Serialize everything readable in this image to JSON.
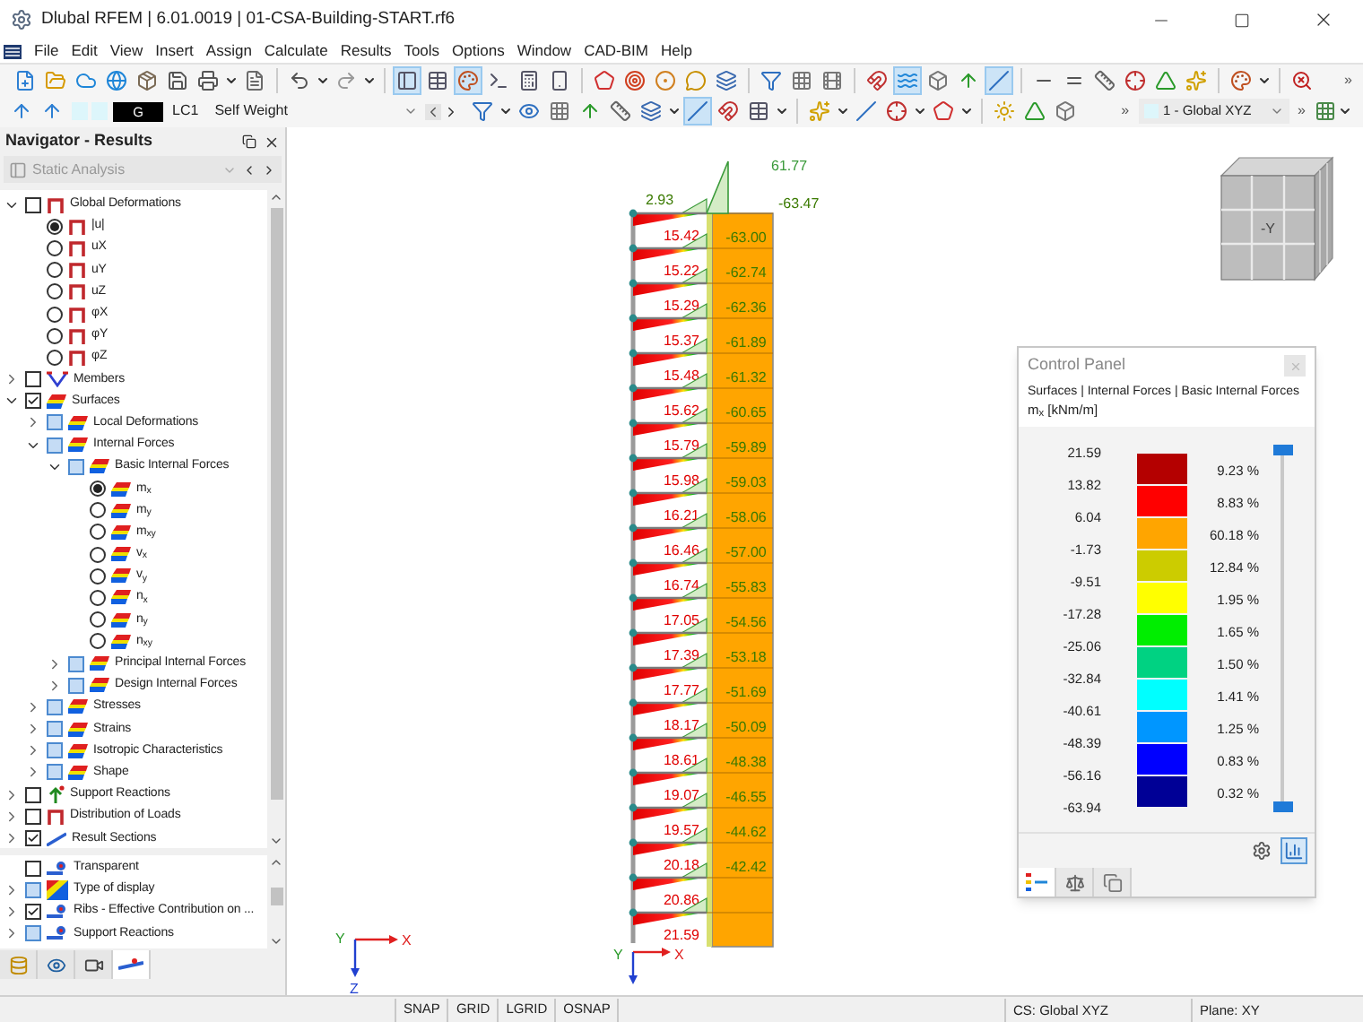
{
  "window": {
    "title": "Dlubal RFEM | 6.01.0019 | 01-CSA-Building-START.rf6"
  },
  "menu": [
    "File",
    "Edit",
    "View",
    "Insert",
    "Assign",
    "Calculate",
    "Results",
    "Tools",
    "Options",
    "Window",
    "CAD-BIM",
    "Help"
  ],
  "toolbar_1": [
    {
      "kind": "new",
      "selected": false
    },
    {
      "kind": "open",
      "selected": false
    },
    {
      "kind": "cloud",
      "selected": false
    },
    {
      "kind": "web",
      "selected": false
    },
    {
      "kind": "box",
      "selected": false
    },
    {
      "kind": "save",
      "selected": false
    },
    {
      "kind": "print",
      "selected": false
    },
    {
      "kind": "caret",
      "selected": false
    },
    {
      "kind": "report",
      "selected": false
    },
    {
      "kind": "sep"
    },
    {
      "kind": "undo",
      "selected": false
    },
    {
      "kind": "caret",
      "selected": false
    },
    {
      "kind": "redo",
      "selected": false
    },
    {
      "kind": "caret",
      "selected": false
    },
    {
      "kind": "sep"
    },
    {
      "kind": "panel",
      "selected": true
    },
    {
      "kind": "table",
      "selected": false
    },
    {
      "kind": "palette",
      "selected": true
    },
    {
      "kind": "terminal",
      "selected": false
    },
    {
      "kind": "calculator",
      "selected": false
    },
    {
      "kind": "phone",
      "selected": false
    },
    {
      "kind": "sep"
    },
    {
      "kind": "pentagon",
      "selected": false
    },
    {
      "kind": "target",
      "selected": false
    },
    {
      "kind": "dot",
      "selected": false
    },
    {
      "kind": "speech",
      "selected": false
    },
    {
      "kind": "layers",
      "selected": false
    },
    {
      "kind": "sep"
    },
    {
      "kind": "filter",
      "selected": false
    },
    {
      "kind": "grid",
      "selected": false
    },
    {
      "kind": "film",
      "selected": false
    },
    {
      "kind": "sep"
    },
    {
      "kind": "magnet",
      "selected": false
    },
    {
      "kind": "waves",
      "selected": true
    },
    {
      "kind": "cube",
      "selected": false
    },
    {
      "kind": "arrow",
      "selected": false
    },
    {
      "kind": "slash",
      "selected": true
    },
    {
      "kind": "sep"
    },
    {
      "kind": "minus",
      "selected": false
    },
    {
      "kind": "equal",
      "selected": false
    },
    {
      "kind": "ruler",
      "selected": false
    },
    {
      "kind": "crosshair",
      "selected": false
    },
    {
      "kind": "triangle",
      "selected": false
    },
    {
      "kind": "sparkles",
      "selected": false
    },
    {
      "kind": "sep"
    },
    {
      "kind": "palette",
      "selected": false
    },
    {
      "kind": "caret",
      "selected": false
    },
    {
      "kind": "sep"
    },
    {
      "kind": "search-x",
      "selected": false
    }
  ],
  "toolbar_1_more": "»",
  "load_bar": {
    "tag": "G",
    "case": "LC1",
    "case_name": "Self Weight"
  },
  "toolbar_2": [
    {
      "kind": "filter",
      "selected": false
    },
    {
      "kind": "caret",
      "selected": false
    },
    {
      "kind": "eye",
      "selected": false
    },
    {
      "kind": "grid",
      "selected": false
    },
    {
      "kind": "arrow",
      "selected": false
    },
    {
      "kind": "ruler",
      "selected": false
    },
    {
      "kind": "layers",
      "selected": false
    },
    {
      "kind": "caret",
      "selected": false
    },
    {
      "kind": "slash",
      "selected": true
    },
    {
      "kind": "magnet",
      "selected": false
    },
    {
      "kind": "table",
      "selected": false
    },
    {
      "kind": "caret",
      "selected": false
    },
    {
      "kind": "sep"
    },
    {
      "kind": "sparkles",
      "selected": false
    },
    {
      "kind": "caret",
      "selected": false
    },
    {
      "kind": "slash",
      "selected": false
    },
    {
      "kind": "crosshair",
      "selected": false
    },
    {
      "kind": "caret",
      "selected": false
    },
    {
      "kind": "pentagon",
      "selected": false
    },
    {
      "kind": "caret",
      "selected": false
    },
    {
      "kind": "sep"
    },
    {
      "kind": "sun",
      "selected": false
    },
    {
      "kind": "triangle",
      "selected": false
    },
    {
      "kind": "cube",
      "selected": false
    }
  ],
  "toolbar_2_more": "»",
  "cs_select": "1 - Global XYZ",
  "toolbar_2_end_more": "»",
  "navigator": {
    "title": "Navigator - Results",
    "analysis": "Static Analysis",
    "tree": [
      {
        "label": "Global Deformations",
        "expanded": true,
        "checked": false,
        "highlighted": false,
        "kind": "deform",
        "children": [
          {
            "label": "|u|",
            "selected": true,
            "kind": "deform"
          },
          {
            "label": "uX",
            "selected": false,
            "kind": "deform"
          },
          {
            "label": "uY",
            "selected": false,
            "kind": "deform"
          },
          {
            "label": "uZ",
            "selected": false,
            "kind": "deform"
          },
          {
            "label": "φX",
            "selected": false,
            "kind": "deform"
          },
          {
            "label": "φY",
            "selected": false,
            "kind": "deform"
          },
          {
            "label": "φZ",
            "selected": false,
            "kind": "deform"
          }
        ]
      },
      {
        "label": "Members",
        "expanded": false,
        "checked": false,
        "highlighted": false,
        "kind": "member"
      },
      {
        "label": "Surfaces",
        "expanded": true,
        "checked": true,
        "highlighted": false,
        "kind": "surface",
        "children": [
          {
            "label": "Local Deformations",
            "expanded": false,
            "checked": false,
            "highlighted": true,
            "kind": "surface"
          },
          {
            "label": "Internal Forces",
            "expanded": true,
            "checked": false,
            "highlighted": true,
            "kind": "surface",
            "children": [
              {
                "label": "Basic Internal Forces",
                "expanded": true,
                "checked": false,
                "highlighted": true,
                "kind": "surface",
                "children": [
                  {
                    "label": "m$_{x}$",
                    "selected": true,
                    "kind": "surface"
                  },
                  {
                    "label": "m$_{y}$",
                    "selected": false,
                    "kind": "surface"
                  },
                  {
                    "label": "m$_{xy}$",
                    "selected": false,
                    "kind": "surface"
                  },
                  {
                    "label": "v$_{x}$",
                    "selected": false,
                    "kind": "surface"
                  },
                  {
                    "label": "v$_{y}$",
                    "selected": false,
                    "kind": "surface"
                  },
                  {
                    "label": "n$_{x}$",
                    "selected": false,
                    "kind": "surface"
                  },
                  {
                    "label": "n$_{y}$",
                    "selected": false,
                    "kind": "surface"
                  },
                  {
                    "label": "n$_{xy}$",
                    "selected": false,
                    "kind": "surface"
                  }
                ]
              },
              {
                "label": "Principal Internal Forces",
                "expanded": false,
                "checked": false,
                "highlighted": true,
                "kind": "surface"
              },
              {
                "label": "Design Internal Forces",
                "expanded": false,
                "checked": false,
                "highlighted": true,
                "kind": "surface"
              }
            ]
          },
          {
            "label": "Stresses",
            "expanded": false,
            "checked": false,
            "highlighted": true,
            "kind": "surface"
          },
          {
            "label": "Strains",
            "expanded": false,
            "checked": false,
            "highlighted": true,
            "kind": "surface"
          },
          {
            "label": "Isotropic Characteristics",
            "expanded": false,
            "checked": false,
            "highlighted": true,
            "kind": "surface"
          },
          {
            "label": "Shape",
            "expanded": false,
            "checked": false,
            "highlighted": true,
            "kind": "surface"
          }
        ]
      },
      {
        "label": "Support Reactions",
        "expanded": false,
        "checked": false,
        "highlighted": false,
        "kind": "support"
      },
      {
        "label": "Distribution of Loads",
        "expanded": false,
        "checked": false,
        "highlighted": false,
        "kind": "deform"
      },
      {
        "label": "Result Sections",
        "expanded": false,
        "checked": true,
        "highlighted": false,
        "kind": "section"
      }
    ],
    "display_tree": [
      {
        "label": "Transparent",
        "checked": false,
        "highlighted": false,
        "kind": "rib"
      },
      {
        "label": "Type of display",
        "expanded": false,
        "checked": false,
        "highlighted": true,
        "kind": "display"
      },
      {
        "label": "Ribs - Effective Contribution on ...",
        "expanded": false,
        "checked": true,
        "highlighted": false,
        "kind": "rib"
      },
      {
        "label": "Support Reactions",
        "expanded": false,
        "checked": false,
        "highlighted": true,
        "kind": "rib"
      }
    ],
    "tabs": [
      {
        "kind": "data",
        "selected": false
      },
      {
        "kind": "view",
        "selected": false
      },
      {
        "kind": "camera",
        "selected": false
      },
      {
        "kind": "results",
        "selected": true
      }
    ]
  },
  "model": {
    "top_labels": [
      "2.93",
      "61.77",
      "-63.47"
    ],
    "slab_values": [
      "15.42",
      "15.22",
      "15.29",
      "15.37",
      "15.48",
      "15.62",
      "15.79",
      "15.98",
      "16.21",
      "16.46",
      "16.74",
      "17.05",
      "17.39",
      "17.77",
      "18.17",
      "18.61",
      "19.07",
      "19.57",
      "20.18",
      "20.86",
      "21.59"
    ],
    "wall_values": [
      "-63.00",
      "-62.74",
      "-62.36",
      "-61.89",
      "-61.32",
      "-60.65",
      "-59.89",
      "-59.03",
      "-58.06",
      "-57.00",
      "-55.83",
      "-54.56",
      "-53.18",
      "-51.69",
      "-50.09",
      "-48.38",
      "-46.55",
      "-44.62",
      "-42.42"
    ],
    "axes": {
      "x": "X",
      "y": "Y"
    }
  },
  "global_axes": {
    "x": "X",
    "y": "Y",
    "z": "Z"
  },
  "view_cube": {
    "face": "-Y"
  },
  "control_panel": {
    "title": "Control Panel",
    "path": "Surfaces | Internal Forces | Basic Internal Forces",
    "quantity": "m$_{x}$ [kNm/m]",
    "values": [
      "21.59",
      "13.82",
      "6.04",
      "-1.73",
      "-9.51",
      "-17.28",
      "-25.06",
      "-32.84",
      "-40.61",
      "-48.39",
      "-56.16",
      "-63.94"
    ],
    "bands": [
      {
        "color": "#b40000",
        "percent": "9.23 %"
      },
      {
        "color": "#ff0000",
        "percent": "8.83 %"
      },
      {
        "color": "#ffa500",
        "percent": "60.18 %"
      },
      {
        "color": "#cccc00",
        "percent": "12.84 %"
      },
      {
        "color": "#ffff00",
        "percent": "1.95 %"
      },
      {
        "color": "#00ee00",
        "percent": "1.65 %"
      },
      {
        "color": "#00d282",
        "percent": "1.50 %"
      },
      {
        "color": "#00ffff",
        "percent": "1.41 %"
      },
      {
        "color": "#0096ff",
        "percent": "1.25 %"
      },
      {
        "color": "#0000ff",
        "percent": "0.83 %"
      },
      {
        "color": "#000096",
        "percent": "0.32 %"
      }
    ],
    "range_thumbs": [
      {
        "level": 1
      },
      {
        "level": 0
      }
    ],
    "buttons": [
      {
        "kind": "settings",
        "selected": false
      },
      {
        "kind": "scale",
        "selected": true
      }
    ],
    "tabs": [
      {
        "kind": "legend",
        "selected": true
      },
      {
        "kind": "balance",
        "selected": false
      },
      {
        "kind": "factors",
        "selected": false
      }
    ]
  },
  "status_bar": {
    "toggles": [
      "SNAP",
      "GRID",
      "LGRID",
      "OSNAP"
    ],
    "cs": "CS: Global XYZ",
    "plane": "Plane: XY"
  }
}
